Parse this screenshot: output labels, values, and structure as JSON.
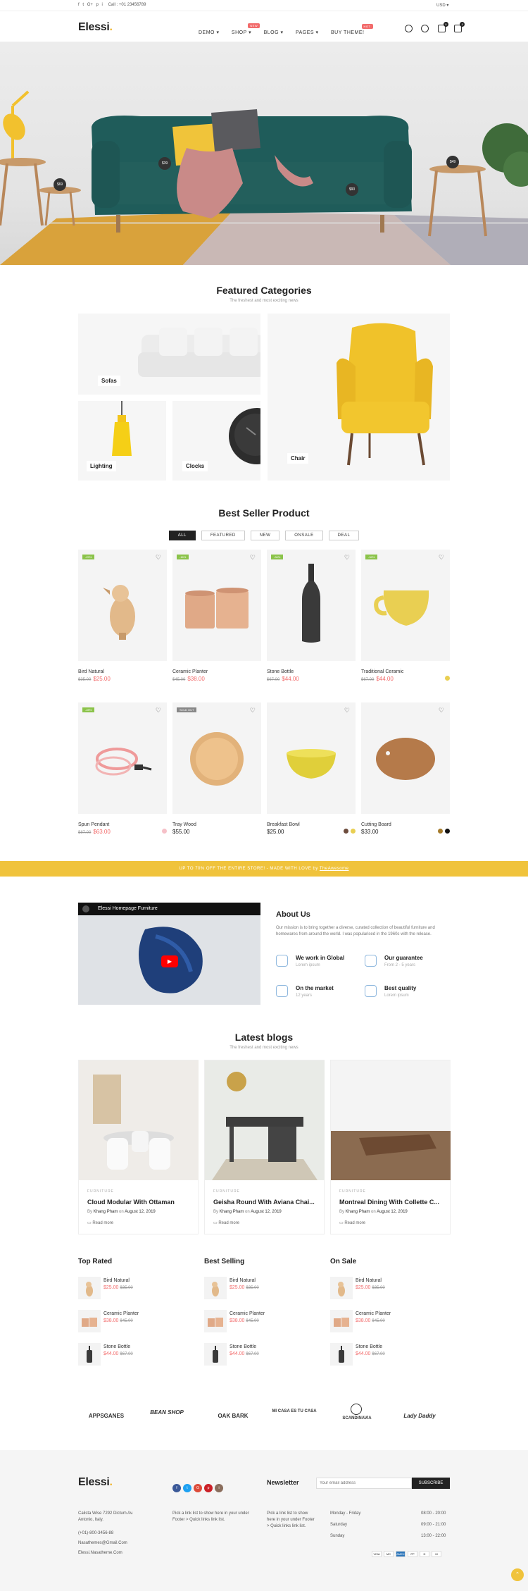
{
  "topbar": {
    "social": [
      "f",
      "t",
      "G+",
      "p",
      "i"
    ],
    "phone": "Call : +01 23456789",
    "currency": "USD"
  },
  "header": {
    "logo": "Elessi",
    "nav": [
      {
        "label": "DEMO",
        "tag": ""
      },
      {
        "label": "SHOP",
        "tag": "NEW"
      },
      {
        "label": "BLOG",
        "tag": ""
      },
      {
        "label": "PAGES",
        "tag": ""
      },
      {
        "label": "BUY THEME!",
        "tag": "HOT"
      }
    ],
    "wishlist_count": "0",
    "cart_count": "0"
  },
  "hero": {
    "hotspots": [
      "$39",
      "$69",
      "$90",
      "$49"
    ]
  },
  "categories": {
    "title": "Featured Categories",
    "subtitle": "The freshest and most exciting news",
    "items": [
      "Sofas",
      "Lighting",
      "Clocks",
      "Chair"
    ]
  },
  "bestseller": {
    "title": "Best Seller Product",
    "tabs": [
      "ALL",
      "FEATURED",
      "NEW",
      "ONSALE",
      "DEAL"
    ],
    "products": [
      {
        "name": "Bird Natural",
        "old": "$35.00",
        "price": "$25.00",
        "label": "-29%"
      },
      {
        "name": "Ceramic Planter",
        "old": "$45.00",
        "price": "$38.00",
        "label": "-16%"
      },
      {
        "name": "Stone Bottle",
        "old": "$67.00",
        "price": "$44.00",
        "label": "-34%"
      },
      {
        "name": "Traditional Ceramic",
        "old": "$67.00",
        "price": "$44.00",
        "label": "-34%"
      },
      {
        "name": "Spun Pendant",
        "old": "$87.00",
        "price": "$63.00",
        "label": "-28%"
      },
      {
        "name": "Tray Wood",
        "old": "",
        "price": "$55.00",
        "label": "SOLD OUT"
      },
      {
        "name": "Breakfast Bowl",
        "old": "",
        "price": "$25.00",
        "label": ""
      },
      {
        "name": "Cutting Board",
        "old": "",
        "price": "$33.00",
        "label": ""
      }
    ]
  },
  "banner": {
    "text": "UP TO 70% OFF THE ENTIRE STORE! - MADE WITH LOVE by ",
    "link": "TheAwesome"
  },
  "about": {
    "video_title": "Elessi Homepage Furniture",
    "title": "About Us",
    "text": "Our mission is to bring together a diverse, curated collection of beautiful furniture and homewares from around the world. I was popularised in the 1960s with the release.",
    "features": [
      {
        "t": "We work in Global",
        "s": "Lorem ipsum"
      },
      {
        "t": "Our guarantee",
        "s": "From 2 - 5 years"
      },
      {
        "t": "On the market",
        "s": "12 years"
      },
      {
        "t": "Best quality",
        "s": "Lorem ipsum"
      }
    ]
  },
  "blogs": {
    "title": "Latest blogs",
    "subtitle": "The freshest and most exciting news",
    "read": "Read more",
    "items": [
      {
        "cat": "FURNITURE",
        "title": "Cloud Modular With Ottaman",
        "author": "Khang Pham",
        "date": "August 12, 2019"
      },
      {
        "cat": "FURNITURE",
        "title": "Geisha Round With Aviana Chai...",
        "author": "Khang Pham",
        "date": "August 12, 2019"
      },
      {
        "cat": "FURNITURE",
        "title": "Montreal Dining With Collette C...",
        "author": "Khang Pham",
        "date": "August 12, 2019"
      }
    ]
  },
  "lists": {
    "cols": [
      "Top Rated",
      "Best Selling",
      "On Sale"
    ],
    "items": [
      {
        "name": "Bird Natural",
        "price": "$25.00",
        "old": "$35.00"
      },
      {
        "name": "Ceramic Planter",
        "price": "$38.00",
        "old": "$45.00"
      },
      {
        "name": "Stone Bottle",
        "price": "$44.00",
        "old": "$67.00"
      }
    ]
  },
  "brands": [
    "APPSGANES",
    "BEAN SHOP",
    "OAK BARK",
    "MI CASA ES TU CASA",
    "SCANDINAVIA",
    "Lady Daddy"
  ],
  "footer": {
    "logo": "Elessi",
    "address": "Calista Wise 7292 Dictum Av. Antonio, Italy.",
    "phone": "(+01)-800-3456-88",
    "email": "Nasathemes@Gmail.Com",
    "site": "Elessi.Nasatheme.Com",
    "col2": "Pick a link list to show here in your under Footer > Quick links link list.",
    "col3": "Pick a link list to show here in your under Footer > Quick links link list.",
    "newsletter": "Newsletter",
    "placeholder": "Your email address",
    "subscribe": "SUBSCRIBE",
    "hours": [
      {
        "d": "Monday - Friday",
        "h": "08:00 - 20:00"
      },
      {
        "d": "Saturday",
        "h": "09:00 - 21:00"
      },
      {
        "d": "Sunday",
        "h": "13:00 - 22:00"
      }
    ],
    "payments": [
      "VISA",
      "MC",
      "AMEX",
      "PP",
      "D",
      "M"
    ]
  }
}
